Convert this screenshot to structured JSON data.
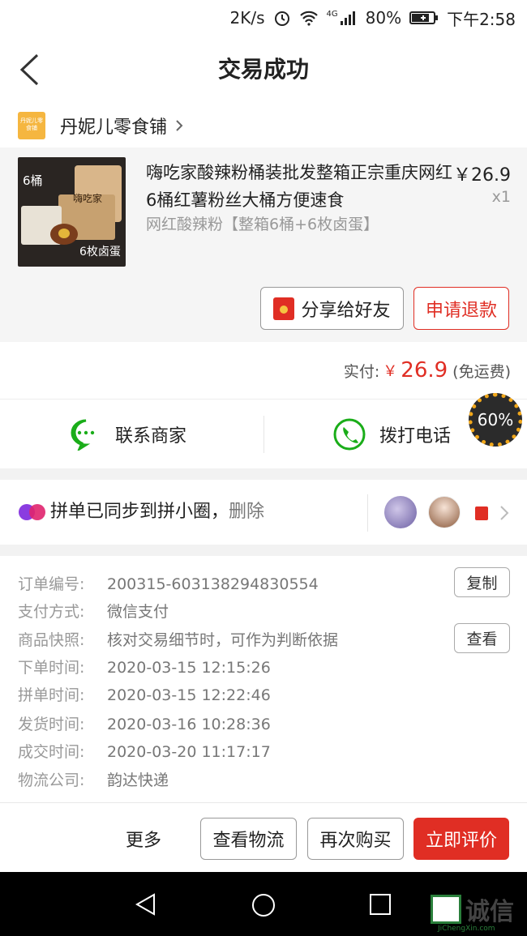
{
  "status_bar": {
    "speed": "2K/s",
    "network": "4G",
    "battery": "80%",
    "time": "下午2:58"
  },
  "header": {
    "title": "交易成功"
  },
  "shop": {
    "logo_text": "丹妮儿零食铺",
    "name": "丹妮儿零食铺"
  },
  "goods": {
    "title": "嗨吃家酸辣粉桶装批发整箱正宗重庆网红6桶红薯粉丝大桶方便速食",
    "spec": "网红酸辣粉【整箱6桶+6枚卤蛋】",
    "price": "￥26.9",
    "qty": "x1",
    "image_tag_top": "6桶",
    "image_tag_bottom": "6枚卤蛋",
    "image_brand": "嗨吃家"
  },
  "actions": {
    "share": "分享给好友",
    "refund": "申请退款"
  },
  "payment": {
    "label": "实付:",
    "currency": "￥",
    "amount": "26.9",
    "note": "(免运费)"
  },
  "contact": {
    "merchant": "联系商家",
    "call": "拨打电话"
  },
  "progress": {
    "label": "60%",
    "value": 0.6
  },
  "sync": {
    "text": "拼单已同步到拼小圈，",
    "delete": "删除"
  },
  "info": [
    {
      "label": "订单编号:",
      "value": "200315-603138294830554"
    },
    {
      "label": "支付方式:",
      "value": "微信支付"
    },
    {
      "label": "商品快照:",
      "value": "核对交易细节时，可作为判断依据"
    },
    {
      "label": "下单时间:",
      "value": "2020-03-15 12:15:26"
    },
    {
      "label": "拼单时间:",
      "value": "2020-03-15 12:22:46"
    },
    {
      "label": "发货时间:",
      "value": "2020-03-16 10:28:36"
    },
    {
      "label": "成交时间:",
      "value": "2020-03-20 11:17:17"
    },
    {
      "label": "物流公司:",
      "value": "韵达快递"
    }
  ],
  "info_buttons": {
    "copy": "复制",
    "view": "查看"
  },
  "bottom": {
    "more": "更多",
    "logistics": "查看物流",
    "rebuy": "再次购买",
    "review": "立即评价"
  },
  "watermark": {
    "text": "诚信",
    "sub": "JiChengXin.com"
  },
  "colors": {
    "accent": "#e02e24",
    "wechat_green": "#1aad19",
    "ring": "#f1a71a"
  }
}
